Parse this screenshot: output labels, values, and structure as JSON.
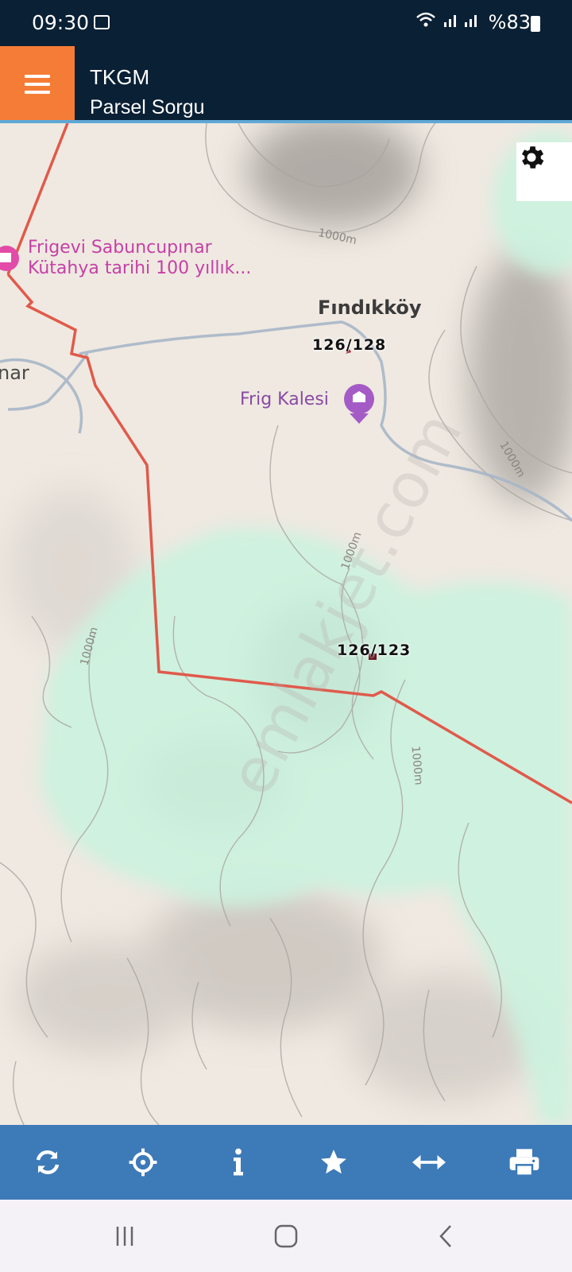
{
  "status": {
    "time": "09:30",
    "battery": "%83"
  },
  "header": {
    "title": "TKGM",
    "subtitle": "Parsel Sorgu"
  },
  "map": {
    "poi_1_line1": "Frigevi Sabuncupınar",
    "poi_1_line2": "Kütahya tarihi 100 yıllık...",
    "village_name": "Fındıkköy",
    "partial_label": "nar",
    "landmark": "Frig Kalesi",
    "parcel_1": "126/128",
    "parcel_2": "126/123",
    "contour_label": "1000m",
    "watermark": "emlakjet.com"
  },
  "toolbar": {
    "buttons": [
      "refresh",
      "locate",
      "info",
      "favorite",
      "measure",
      "print"
    ]
  },
  "colors": {
    "header_bg": "#0a2035",
    "menu_accent": "#f47c36",
    "toolbar_bg": "#3d7ab8",
    "boundary_line": "#e05a4b",
    "forest": "#c9f2de"
  }
}
